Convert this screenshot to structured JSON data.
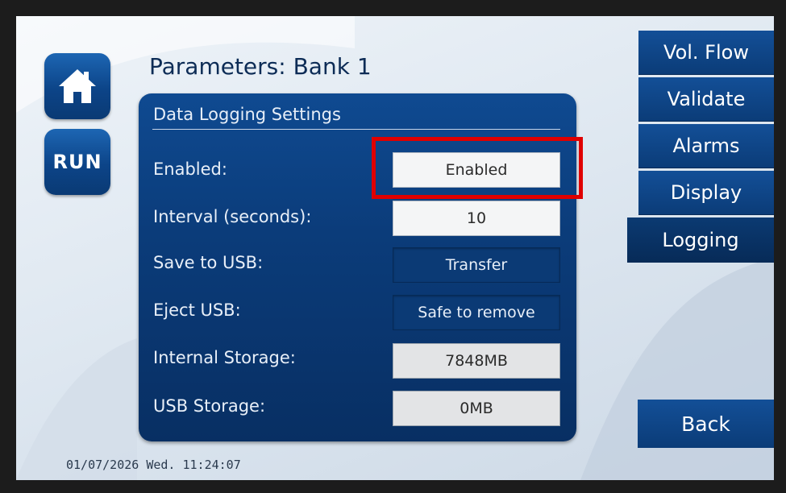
{
  "header": {
    "title": "Parameters: Bank 1"
  },
  "left_buttons": {
    "home_icon": "home-icon",
    "run_label": "RUN"
  },
  "panel": {
    "heading": "Data Logging Settings",
    "rows": [
      {
        "label": "Enabled:",
        "value": "Enabled",
        "style": "light",
        "highlighted": true
      },
      {
        "label": "Interval (seconds):",
        "value": "10",
        "style": "light"
      },
      {
        "label": "Save to USB:",
        "value": "Transfer",
        "style": "dark"
      },
      {
        "label": "Eject USB:",
        "value": "Safe to remove",
        "style": "dark"
      },
      {
        "label": "Internal Storage:",
        "value": "7848MB",
        "style": "grey"
      },
      {
        "label": "USB Storage:",
        "value": "0MB",
        "style": "grey"
      }
    ]
  },
  "side_tabs": [
    {
      "label": "Vol. Flow"
    },
    {
      "label": "Validate"
    },
    {
      "label": "Alarms"
    },
    {
      "label": "Display"
    },
    {
      "label": "Logging",
      "active": true
    }
  ],
  "back_label": "Back",
  "status": {
    "datetime": "01/07/2026 Wed. 11:24:07"
  },
  "colors": {
    "panel_blue": "#0b3c7a",
    "highlight": "#e00000"
  }
}
